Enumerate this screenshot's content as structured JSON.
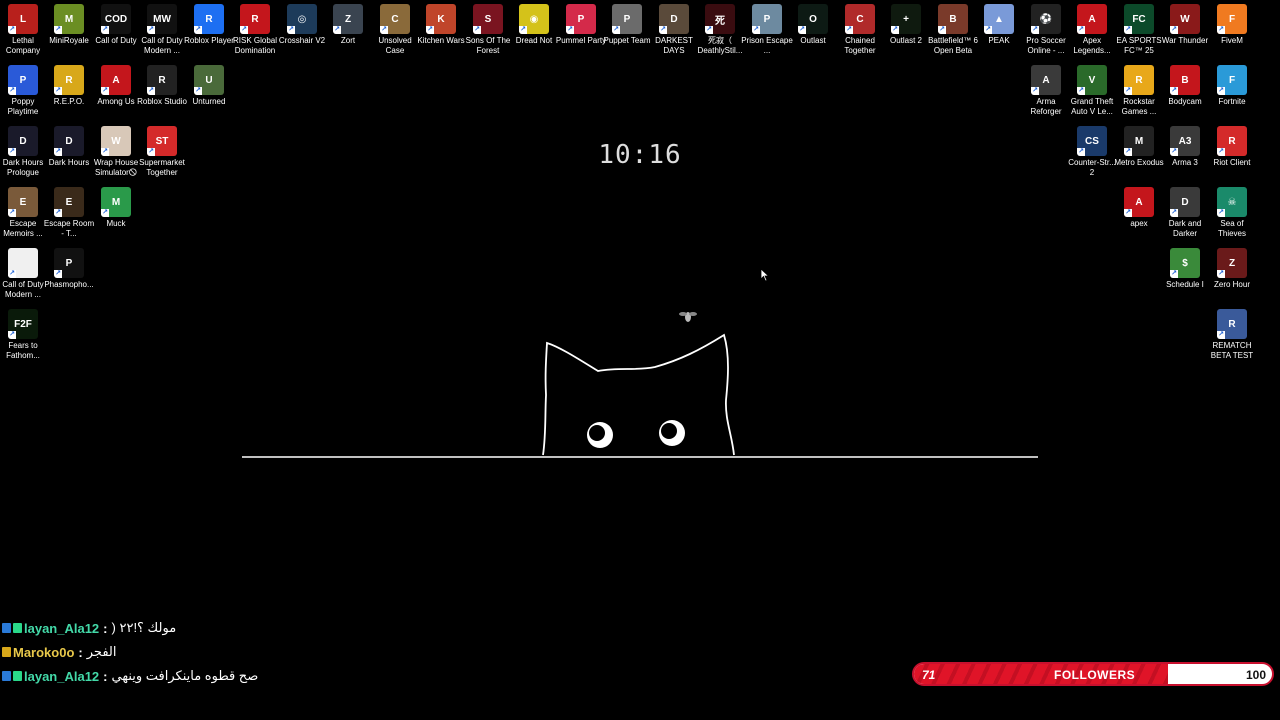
{
  "desktop": {
    "clock": "10:16",
    "icons": [
      {
        "label": "Lethal Company",
        "color": "#b8201c",
        "glyph": "L",
        "icon": "lethal-company-icon"
      },
      {
        "label": "MiniRoyale",
        "color": "#6b8e23",
        "glyph": "M",
        "icon": "miniroyale-icon"
      },
      {
        "label": "Call of Duty",
        "color": "#111111",
        "glyph": "COD",
        "icon": "call-of-duty-icon"
      },
      {
        "label": "Call of Duty Modern ...",
        "color": "#111111",
        "glyph": "MW",
        "icon": "call-of-duty-mw-icon"
      },
      {
        "label": "Roblox Player",
        "color": "#1d6ff2",
        "glyph": "R",
        "icon": "roblox-player-icon"
      },
      {
        "label": "RISK Global Domination",
        "color": "#c4161c",
        "glyph": "R",
        "icon": "risk-icon"
      },
      {
        "label": "Crosshair V2",
        "color": "#1d3b5a",
        "glyph": "◎",
        "icon": "crosshair-icon"
      },
      {
        "label": "Zort",
        "color": "#3a4450",
        "glyph": "Z",
        "icon": "zort-icon"
      },
      {
        "label": "Unsolved Case",
        "color": "#8a6a3a",
        "glyph": "C",
        "icon": "unsolved-case-icon"
      },
      {
        "label": "Kitchen Wars",
        "color": "#c0452a",
        "glyph": "K",
        "icon": "kitchen-wars-icon"
      },
      {
        "label": "Sons Of The Forest",
        "color": "#7a1420",
        "glyph": "S",
        "icon": "sons-of-the-forest-icon"
      },
      {
        "label": "Dread Not",
        "color": "#d4c21a",
        "glyph": "◉",
        "icon": "dread-not-icon"
      },
      {
        "label": "Pummel Party",
        "color": "#d42a4a",
        "glyph": "P",
        "icon": "pummel-party-icon"
      },
      {
        "label": "Puppet Team",
        "color": "#6b6b6b",
        "glyph": "P",
        "icon": "puppet-team-icon"
      },
      {
        "label": "DARKEST DAYS",
        "color": "#5a4a3a",
        "glyph": "D",
        "icon": "darkest-days-icon"
      },
      {
        "label": "死寂（ DeathlyStil...",
        "color": "#3a0c10",
        "glyph": "死",
        "icon": "deathly-still-icon"
      },
      {
        "label": "Prison Escape ...",
        "color": "#6d8aa0",
        "glyph": "P",
        "icon": "prison-escape-icon"
      },
      {
        "label": "Outlast",
        "color": "#0d1a14",
        "glyph": "O",
        "icon": "outlast-icon"
      },
      {
        "label": "Chained Together",
        "color": "#b02a2a",
        "glyph": "C",
        "icon": "chained-together-icon"
      },
      {
        "label": "Outlast 2",
        "color": "#0f1a0f",
        "glyph": "+",
        "icon": "outlast-2-icon"
      },
      {
        "label": "Battlefield™ 6 Open Beta",
        "color": "#7a3a2a",
        "glyph": "B",
        "icon": "battlefield-icon"
      },
      {
        "label": "PEAK",
        "color": "#7a9ad8",
        "glyph": "▲",
        "icon": "peak-icon"
      },
      {
        "label": "Pro Soccer Online - ...",
        "color": "#222222",
        "glyph": "⚽",
        "icon": "pro-soccer-icon"
      },
      {
        "label": "Apex Legends...",
        "color": "#c4161c",
        "glyph": "A",
        "icon": "apex-legends-icon"
      },
      {
        "label": "EA SPORTS FC™ 25",
        "color": "#0c4a2a",
        "glyph": "FC",
        "icon": "ea-fc-icon"
      },
      {
        "label": "War Thunder",
        "color": "#8a1a1a",
        "glyph": "W",
        "icon": "war-thunder-icon"
      },
      {
        "label": "FiveM",
        "color": "#f07a20",
        "glyph": "F",
        "icon": "fivem-icon"
      },
      {
        "label": "Poppy Playtime",
        "color": "#2a5ad8",
        "glyph": "P",
        "icon": "poppy-playtime-icon"
      },
      {
        "label": "R.E.P.O.",
        "color": "#d8a81a",
        "glyph": "R",
        "icon": "repo-icon"
      },
      {
        "label": "Among Us",
        "color": "#c4161c",
        "glyph": "A",
        "icon": "among-us-icon"
      },
      {
        "label": "Roblox Studio",
        "color": "#222222",
        "glyph": "R",
        "icon": "roblox-studio-icon"
      },
      {
        "label": "Unturned",
        "color": "#4a6a3a",
        "glyph": "U",
        "icon": "unturned-icon"
      },
      {
        "label": "Arma Reforger",
        "color": "#3a3a3a",
        "glyph": "A",
        "icon": "arma-reforger-icon"
      },
      {
        "label": "Grand Theft Auto V Le...",
        "color": "#2a6a2a",
        "glyph": "V",
        "icon": "gta-v-icon"
      },
      {
        "label": "Rockstar Games ...",
        "color": "#e8a81a",
        "glyph": "R",
        "icon": "rockstar-icon"
      },
      {
        "label": "Bodycam",
        "color": "#c4161c",
        "glyph": "B",
        "icon": "bodycam-icon"
      },
      {
        "label": "Fortnite",
        "color": "#2a9ad8",
        "glyph": "F",
        "icon": "fortnite-icon"
      },
      {
        "label": "Dark Hours Prologue",
        "color": "#1a1a2a",
        "glyph": "D",
        "icon": "dark-hours-prologue-icon"
      },
      {
        "label": "Dark Hours",
        "color": "#1a1a2a",
        "glyph": "D",
        "icon": "dark-hours-icon"
      },
      {
        "label": "Wrap House Simulator🛇",
        "color": "#d8c8b8",
        "glyph": "W",
        "icon": "wrap-house-icon"
      },
      {
        "label": "Supermarket Together",
        "color": "#d42a2a",
        "glyph": "ST",
        "icon": "supermarket-together-icon"
      },
      {
        "label": "Counter-Str... 2",
        "color": "#1a3a6a",
        "glyph": "CS",
        "icon": "counter-strike-icon"
      },
      {
        "label": "Metro Exodus",
        "color": "#222222",
        "glyph": "M",
        "icon": "metro-exodus-icon"
      },
      {
        "label": "Arma 3",
        "color": "#3a3a3a",
        "glyph": "A3",
        "icon": "arma-3-icon"
      },
      {
        "label": "Riot Client",
        "color": "#d42a2a",
        "glyph": "R",
        "icon": "riot-client-icon"
      },
      {
        "label": "Escape Memoirs ...",
        "color": "#7a5a3a",
        "glyph": "E",
        "icon": "escape-memoirs-icon"
      },
      {
        "label": "Escape Room - T...",
        "color": "#3a2a1a",
        "glyph": "E",
        "icon": "escape-room-icon"
      },
      {
        "label": "Muck",
        "color": "#2a9a4a",
        "glyph": "M",
        "icon": "muck-icon"
      },
      {
        "label": "apex",
        "color": "#c4161c",
        "glyph": "A",
        "icon": "apex-icon"
      },
      {
        "label": "Dark and Darker",
        "color": "#3a3a3a",
        "glyph": "D",
        "icon": "dark-and-darker-icon"
      },
      {
        "label": "Sea of Thieves",
        "color": "#1a8a6a",
        "glyph": "☠",
        "icon": "sea-of-thieves-icon"
      },
      {
        "label": "Call of Duty Modern ...",
        "color": "#f0f0f0",
        "glyph": "",
        "icon": "file-icon"
      },
      {
        "label": "Phasmopho...",
        "color": "#111111",
        "glyph": "P",
        "icon": "phasmophobia-icon"
      },
      {
        "label": "Schedule I",
        "color": "#3a8a3a",
        "glyph": "$",
        "icon": "schedule-i-icon"
      },
      {
        "label": "Zero Hour",
        "color": "#6a1a1a",
        "glyph": "Z",
        "icon": "zero-hour-icon"
      },
      {
        "label": "Fears to Fathom...",
        "color": "#0a1a0a",
        "glyph": "F2F",
        "icon": "fears-to-fathom-icon"
      },
      {
        "label": "REMATCH BETA TEST",
        "color": "#3a5a9a",
        "glyph": "R",
        "icon": "rematch-icon"
      }
    ]
  },
  "chat": [
    {
      "user": "layan_Ala12",
      "message": "مولك ؟!٢٢ (",
      "badge1": "#2a7ad8",
      "badge2": "#2ad88a"
    },
    {
      "user": "Maroko0o",
      "message": "الفجر",
      "badge1": "#d8a81a",
      "badge2": ""
    },
    {
      "user": "layan_Ala12",
      "message": "صح قطوه ماينكرافت وينهي",
      "badge1": "#2a7ad8",
      "badge2": "#2ad88a"
    }
  ],
  "chat_sep": ":",
  "followers": {
    "title": "FOLLOWERS",
    "current": "71",
    "goal": "100",
    "progress": 0.71
  }
}
